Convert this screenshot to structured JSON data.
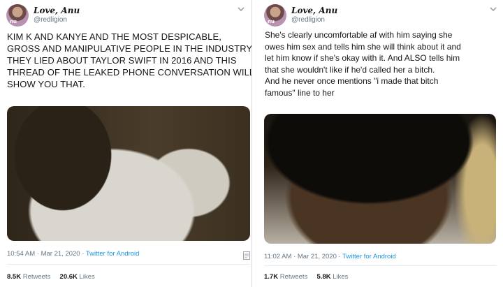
{
  "tweets": [
    {
      "author_name": "Love, Anu",
      "author_handle": "@redligion",
      "avatar_tag": "nu",
      "lines": [
        "KIM K AND KANYE AND THE MOST DESPICABLE,",
        "GROSS AND MANIPULATIVE PEOPLE IN THE INDUSTRY",
        "THEY LIED ABOUT TAYLOR SWIFT IN 2016 AND THIS",
        "THREAD OF THE LEAKED PHONE CONVERSATION WILL",
        "SHOW YOU THAT."
      ],
      "time": "10:54 AM",
      "date": "Mar 21, 2020",
      "source": "Twitter for Android",
      "retweets": "8.5K",
      "retweets_label": "Retweets",
      "likes": "20.6K",
      "likes_label": "Likes",
      "icons": [
        "avatar-photo",
        "chevron-down-icon",
        "document-icon"
      ]
    },
    {
      "author_name": "Love, Anu",
      "author_handle": "@redligion",
      "avatar_tag": "nu",
      "lines": [
        "She's clearly uncomfortable af with him saying she",
        "owes him sex and tells him she will think about it and",
        "let him know if she's okay with it. And ALSO tells him",
        "that she wouldn't like if he'd called her a bitch.",
        "And he never once mentions \"i made that bitch",
        "famous\" line to her"
      ],
      "time": "11:02 AM",
      "date": "Mar 21, 2020",
      "source": "Twitter for Android",
      "retweets": "1.7K",
      "retweets_label": "Retweets",
      "likes": "5.8K",
      "likes_label": "Likes",
      "icons": [
        "avatar-photo",
        "chevron-down-icon"
      ]
    }
  ],
  "separator": " · ",
  "colors": {
    "link": "#1b95e0",
    "muted": "#657786",
    "text": "#14171a"
  }
}
